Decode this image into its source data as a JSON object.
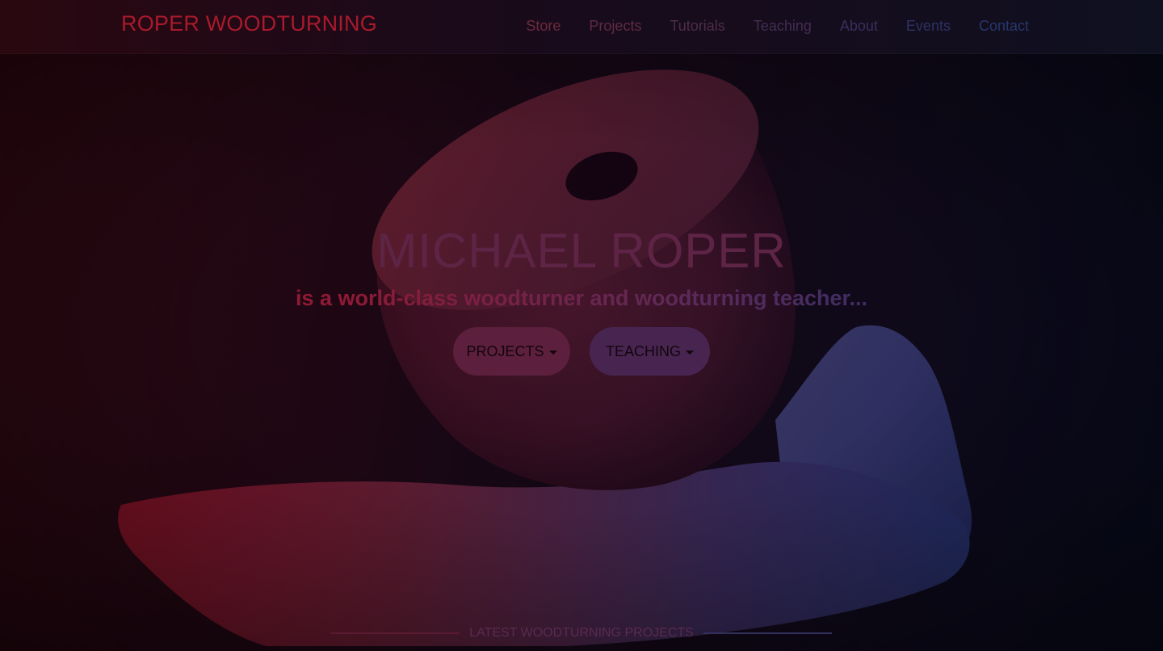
{
  "brand": "ROPER WOODTURNING",
  "nav": {
    "items": [
      {
        "label": "Store"
      },
      {
        "label": "Projects"
      },
      {
        "label": "Tutorials"
      },
      {
        "label": "Teaching"
      },
      {
        "label": "About"
      },
      {
        "label": "Events"
      },
      {
        "label": "Contact"
      }
    ]
  },
  "hero": {
    "title": "MICHAEL ROPER",
    "subtitle": "is a world-class woodturner and woodturning teacher...",
    "buttons": [
      {
        "label": "PROJECTS"
      },
      {
        "label": "TEACHING"
      }
    ]
  },
  "section": {
    "heading": "LATEST WOODTURNING PROJECTS"
  },
  "colors": {
    "brand": "#a81a2c",
    "projects_button": "#5c1f3d",
    "teaching_button": "#482551"
  }
}
